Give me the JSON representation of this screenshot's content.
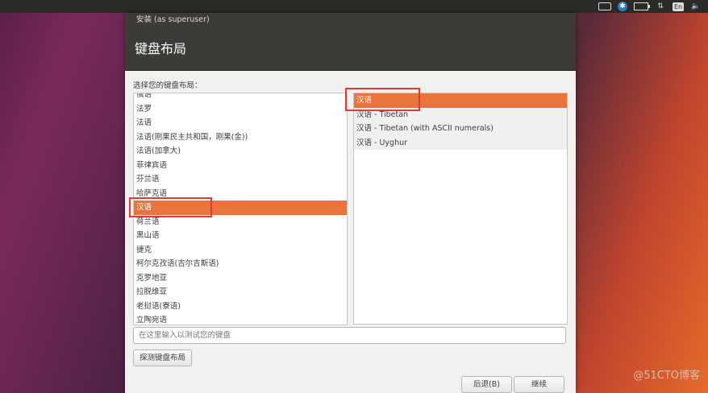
{
  "top_panel": {
    "icons": [
      "keyboard-icon",
      "accessibility-icon",
      "battery-icon",
      "network-icon",
      "input-method-icon",
      "volume-icon"
    ],
    "input_method_label": "En",
    "accessibility_glyph": "✱",
    "network_glyph": "⇅",
    "volume_glyph": "🔈"
  },
  "window": {
    "title": "安装 (as superuser)",
    "header": "键盘布局",
    "prompt": "选择您的键盘布局：",
    "layouts": [
      "俄语",
      "法罗",
      "法语",
      "法语(刚果民主共和国，刚果(金))",
      "法语(加拿大)",
      "菲律宾语",
      "芬兰语",
      "哈萨克语",
      "汉语",
      "荷兰语",
      "黑山语",
      "捷克",
      "柯尔克孜语(吉尔吉斯语)",
      "克罗地亚",
      "拉脱维亚",
      "老挝语(寮语)",
      "立陶宛语"
    ],
    "variants": [
      "汉语",
      "汉语 - Tibetan",
      "汉语 - Tibetan (with ASCII numerals)",
      "汉语 - Uyghur"
    ],
    "test_placeholder": "在这里输入以测试您的键盘",
    "detect_label": "探测键盘布局",
    "back_label": "后退(B)",
    "continue_label": "继续"
  },
  "watermark": "@51CTO博客",
  "colors": {
    "selection": "#e9743e",
    "highlight_box": "#e03a3a",
    "panel": "#2b2a27",
    "header": "#3c3b37"
  }
}
